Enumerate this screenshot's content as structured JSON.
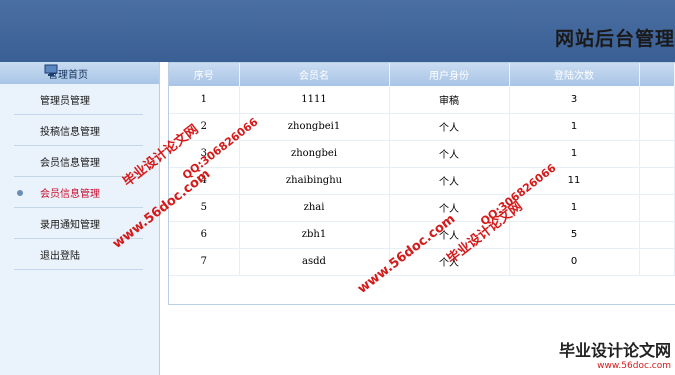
{
  "header": {
    "title": "网站后台管理"
  },
  "sidebar": {
    "home_label": "管理首页",
    "items": [
      {
        "label": "管理员管理",
        "active": false
      },
      {
        "label": "投稿信息管理",
        "active": false
      },
      {
        "label": "会员信息管理",
        "active": false
      },
      {
        "label": "会员信息管理",
        "active": true
      },
      {
        "label": "录用通知管理",
        "active": false
      },
      {
        "label": "退出登陆",
        "active": false
      }
    ]
  },
  "table": {
    "headers": [
      "序号",
      "会员名",
      "用户身份",
      "登陆次数"
    ],
    "rows": [
      [
        "1",
        "1111",
        "审稿",
        "3"
      ],
      [
        "2",
        "zhongbei1",
        "个人",
        "1"
      ],
      [
        "3",
        "zhongbei",
        "个人",
        "1"
      ],
      [
        "4",
        "zhaibinghu",
        "个人",
        "11"
      ],
      [
        "5",
        "zhai",
        "个人",
        "1"
      ],
      [
        "6",
        "zbh1",
        "个人",
        "5"
      ],
      [
        "7",
        "asdd",
        "个人",
        "0"
      ]
    ]
  },
  "watermarks": {
    "brand": "毕业设计论文网",
    "qq": "QQ:306826066",
    "url": "www.56doc.com"
  },
  "footer_logo": {
    "main": "毕业设计论文网",
    "url": "www.56doc.com"
  }
}
